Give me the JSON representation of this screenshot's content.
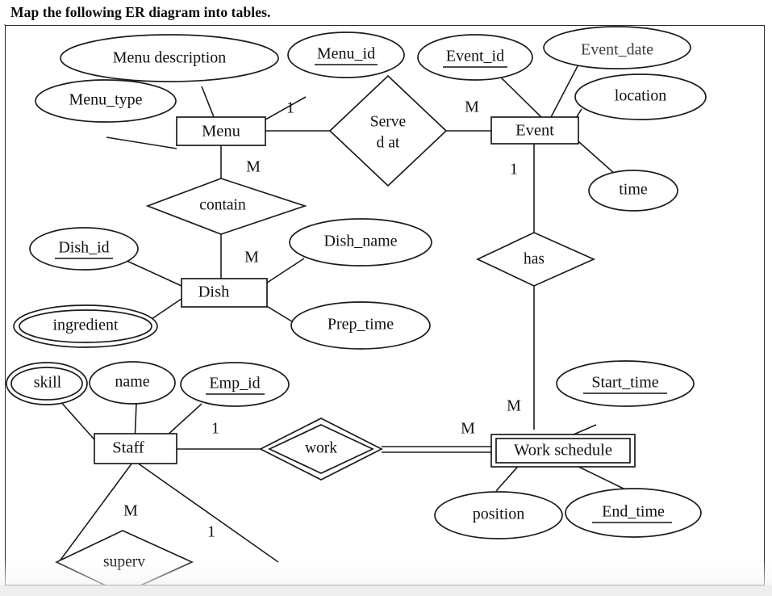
{
  "header": {
    "question": "Map the following ER diagram into tables."
  },
  "diagram": {
    "title": "ER diagram",
    "colors": {
      "stroke": "#1c1c1c",
      "background": "#ffffff",
      "frame_border": "#2b2b2b",
      "text": "#121212"
    },
    "entities": [
      {
        "id": "menu",
        "label": "Menu",
        "type": "strong"
      },
      {
        "id": "event",
        "label": "Event",
        "type": "strong"
      },
      {
        "id": "dish",
        "label": "Dish",
        "type": "strong"
      },
      {
        "id": "staff",
        "label": "Staff",
        "type": "strong"
      },
      {
        "id": "work_schedule",
        "label": "Work schedule",
        "type": "weak"
      }
    ],
    "attributes": [
      {
        "id": "menu_description",
        "label": "Menu  description",
        "owner": "menu",
        "kind": "simple",
        "key": false
      },
      {
        "id": "menu_id",
        "label": "Menu_id",
        "owner": "menu",
        "kind": "simple",
        "key": true
      },
      {
        "id": "menu_type",
        "label": "Menu_type",
        "owner": "menu",
        "kind": "simple",
        "key": false
      },
      {
        "id": "event_id",
        "label": "Event_id",
        "owner": "event",
        "kind": "simple",
        "key": true
      },
      {
        "id": "event_date",
        "label": "Event_date",
        "owner": "event",
        "kind": "simple",
        "key": false
      },
      {
        "id": "location",
        "label": "location",
        "owner": "event",
        "kind": "simple",
        "key": false
      },
      {
        "id": "time",
        "label": "time",
        "owner": "event",
        "kind": "simple",
        "key": false
      },
      {
        "id": "dish_id",
        "label": "Dish_id",
        "owner": "dish",
        "kind": "simple",
        "key": true
      },
      {
        "id": "dish_name",
        "label": "Dish_name",
        "owner": "dish",
        "kind": "simple",
        "key": false
      },
      {
        "id": "ingredient",
        "label": "ingredient",
        "owner": "dish",
        "kind": "multivalued",
        "key": false
      },
      {
        "id": "prep_time",
        "label": "Prep_time",
        "owner": "dish",
        "kind": "simple",
        "key": false
      },
      {
        "id": "skill",
        "label": "skill",
        "owner": "staff",
        "kind": "multivalued",
        "key": false
      },
      {
        "id": "name",
        "label": "name",
        "owner": "staff",
        "kind": "simple",
        "key": false
      },
      {
        "id": "emp_id",
        "label": "Emp_id",
        "owner": "staff",
        "kind": "simple",
        "key": true
      },
      {
        "id": "start_time",
        "label": "Start_time",
        "owner": "work_schedule",
        "kind": "simple",
        "key": true
      },
      {
        "id": "position",
        "label": "position",
        "owner": "work_schedule",
        "kind": "simple",
        "key": false
      },
      {
        "id": "end_time",
        "label": "End_time",
        "owner": "work_schedule",
        "kind": "simple",
        "key": true
      }
    ],
    "relationships": [
      {
        "id": "served_at",
        "label_line1": "Serve",
        "label_line2": "d  at",
        "label": "Served at",
        "type": "normal",
        "from": "menu",
        "to": "event",
        "from_cardinality": "1",
        "to_cardinality": "M"
      },
      {
        "id": "contain",
        "label_line1": "contain",
        "label_line2": "",
        "label": "contain",
        "type": "normal",
        "from": "menu",
        "to": "dish",
        "from_cardinality": "M",
        "to_cardinality": "M"
      },
      {
        "id": "has",
        "label_line1": "has",
        "label_line2": "",
        "label": "has",
        "type": "normal",
        "from": "event",
        "to": "work_schedule",
        "from_cardinality": "1",
        "to_cardinality": "M"
      },
      {
        "id": "work",
        "label_line1": "work",
        "label_line2": "",
        "label": "work",
        "type": "identifying",
        "from": "staff",
        "to": "work_schedule",
        "from_cardinality": "1",
        "to_cardinality": "M"
      },
      {
        "id": "superv",
        "label_line1": "superv",
        "label_line2": "",
        "label": "superv",
        "type": "normal",
        "from": "staff",
        "to": "staff",
        "from_cardinality": "M",
        "to_cardinality": "1"
      }
    ],
    "cardinality_labels": {
      "menu_served_at": "1",
      "event_served_at": "M",
      "menu_contain": "M",
      "dish_contain": "M",
      "event_has": "1",
      "work_schedule_has": "M",
      "staff_work": "1",
      "work_schedule_work": "M",
      "staff_superv_m": "M",
      "staff_superv_1": "1"
    }
  }
}
